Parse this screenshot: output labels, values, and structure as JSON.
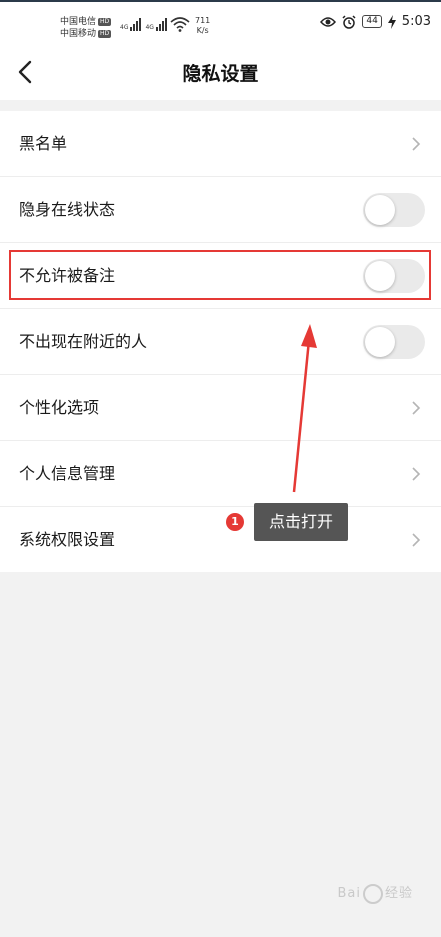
{
  "status_bar": {
    "carrier_1": "中国电信",
    "carrier_2": "中国移动",
    "hd_label": "HD",
    "net_1": "4G",
    "net_2": "4G",
    "speed_value": "711",
    "speed_unit": "K/s",
    "battery": "44",
    "time": "5:03"
  },
  "header": {
    "title": "隐私设置"
  },
  "items": [
    {
      "label": "黑名单",
      "control": "chevron"
    },
    {
      "label": "隐身在线状态",
      "control": "toggle",
      "on": false
    },
    {
      "label": "不允许被备注",
      "control": "toggle",
      "on": false
    },
    {
      "label": "不出现在附近的人",
      "control": "toggle",
      "on": false
    },
    {
      "label": "个性化选项",
      "control": "chevron"
    },
    {
      "label": "个人信息管理",
      "control": "chevron"
    },
    {
      "label": "系统权限设置",
      "control": "chevron"
    }
  ],
  "annotation": {
    "step": "1",
    "text": "点击打开",
    "color": "#e53935"
  },
  "watermark": {
    "text_1": "Bai",
    "text_2": "经验"
  },
  "colors": {
    "toggle_off": "#eaeaea",
    "highlight": "#e53935",
    "background": "#f2f2f2"
  }
}
